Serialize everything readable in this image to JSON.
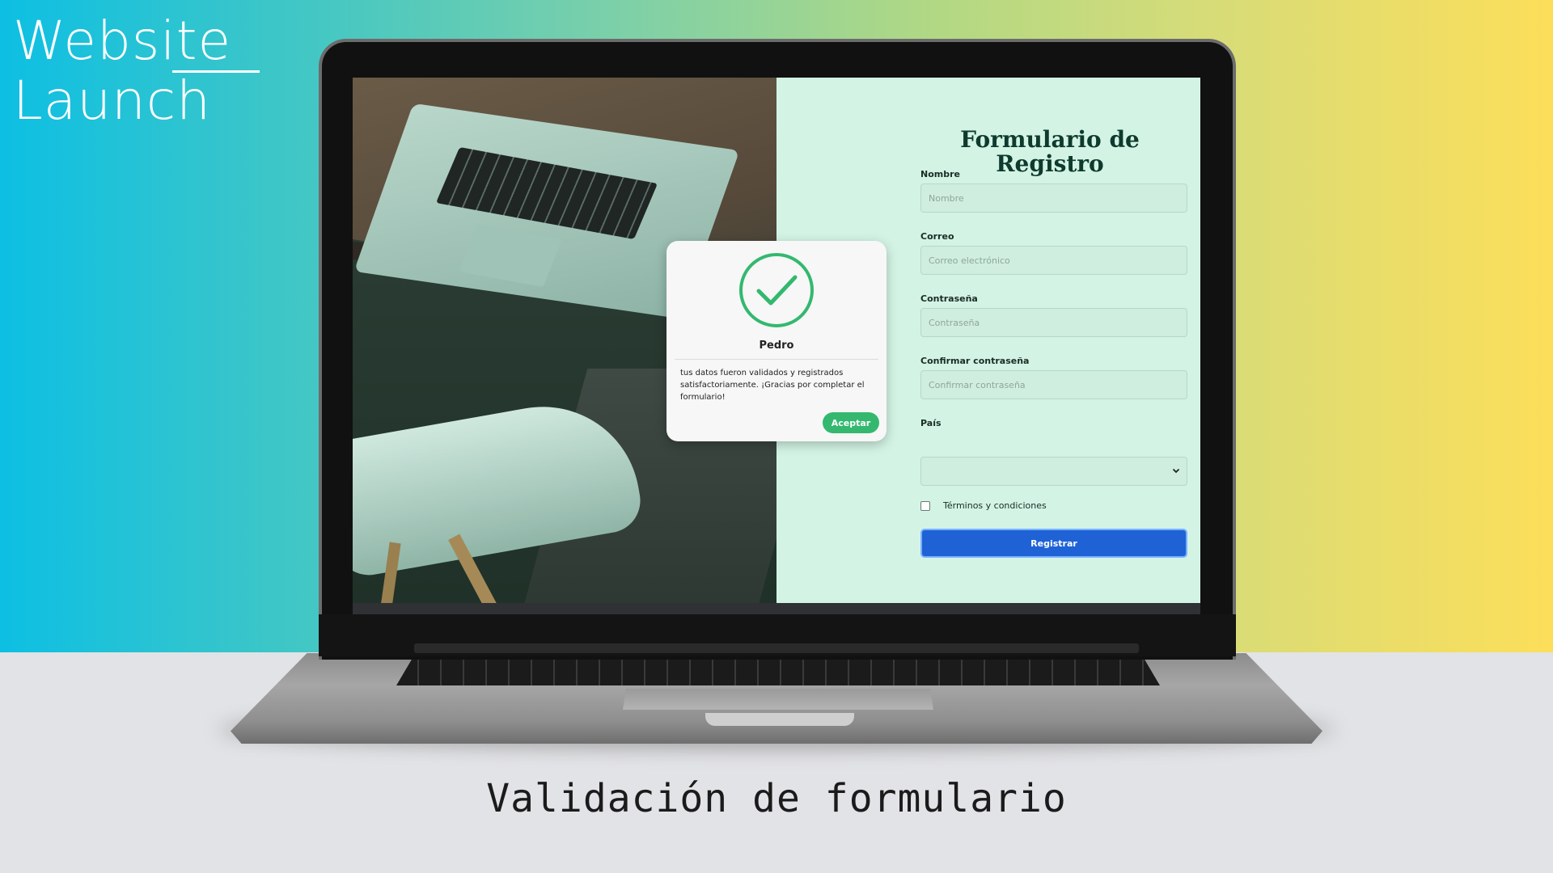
{
  "slide": {
    "brand_line1": "Website",
    "brand_line2": "Launch",
    "caption": "Validación de formulario"
  },
  "form": {
    "title": "Formulario de Registro",
    "fields": [
      {
        "label": "Nombre",
        "placeholder": "Nombre",
        "value": ""
      },
      {
        "label": "Correo",
        "placeholder": "Correo electrónico",
        "value": ""
      },
      {
        "label": "Contraseña",
        "placeholder": "Contraseña",
        "value": ""
      },
      {
        "label": "Confirmar contraseña",
        "placeholder": "Confirmar contraseña",
        "value": ""
      }
    ],
    "country_label": "País",
    "country_value": "",
    "terms_label": "Términos y condiciones",
    "terms_checked": false,
    "submit_label": "Registrar",
    "submit_color": "#1e62d6"
  },
  "modal": {
    "icon": "check-circle-icon",
    "name": "Pedro",
    "message": "tus datos fueron validados y registrados satisfactoriamente. ¡Gracias por completar el formulario!",
    "accept_label": "Aceptar",
    "accent_color": "#34b86f"
  }
}
